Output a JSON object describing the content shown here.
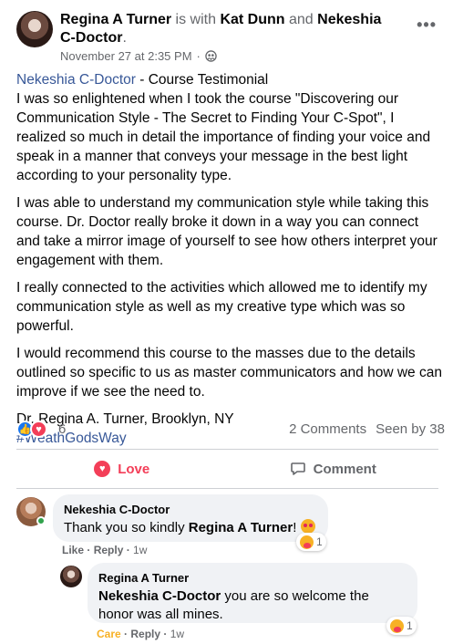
{
  "post": {
    "author": "Regina A Turner",
    "with_text": " is with ",
    "tag1": "Kat Dunn",
    "and_text": " and ",
    "tag2": "Nekeshia C-Doctor",
    "period": ".",
    "timestamp": "November 27 at 2:35 PM",
    "sep": "·",
    "mention": "Nekeshia C-Doctor",
    "subject": " - Course Testimonial",
    "para1": "I was so enlightened when I took the course \"Discovering our Communication Style - The Secret to Finding Your C-Spot\", I realized so much in detail the importance of finding your voice and speak in a manner that conveys your message in the best light according to your personality type.",
    "para2": "I was able to understand my communication style while taking this course. Dr. Doctor really broke it down in a way you can connect and take a mirror image of yourself to see how others interpret your engagement with them.",
    "para3": "I really connected to the activities which allowed me to identify my communication style as well as my creative type which was so powerful.",
    "para4": "I would recommend this course to the masses due to the details outlined so specific to us as master communicators and how we can improve if we see the need to.",
    "signature": "Dr. Regina A. Turner, Brooklyn, NY",
    "hashtag": "#WeathGodsWay"
  },
  "reactions": {
    "count": "6",
    "comments": "2 Comments",
    "seen": "Seen by 38"
  },
  "actions": {
    "love": "Love",
    "comment": "Comment"
  },
  "comments": [
    {
      "author": "Nekeshia C-Doctor",
      "text_prefix": "Thank you so kindly ",
      "mention": "Regina A Turner",
      "text_suffix": "! ",
      "like": "Like",
      "reply": "Reply",
      "time": "1w",
      "react_count": "1"
    },
    {
      "author": "Regina A Turner",
      "mention": "Nekeshia C-Doctor",
      "text": " you are so welcome the honor was all mines.",
      "care": "Care",
      "reply": "Reply",
      "time": "1w",
      "react_count": "1"
    }
  ],
  "icons": {
    "privacy": "friends-globe-icon",
    "more": "more-options-icon",
    "like": "like-reaction-icon",
    "love": "love-reaction-icon",
    "comment": "comment-bubble-icon",
    "care": "care-reaction-icon"
  },
  "colors": {
    "link": "#385898",
    "love": "#f33e58",
    "like": "#1877f2",
    "care": "#f7b125"
  }
}
